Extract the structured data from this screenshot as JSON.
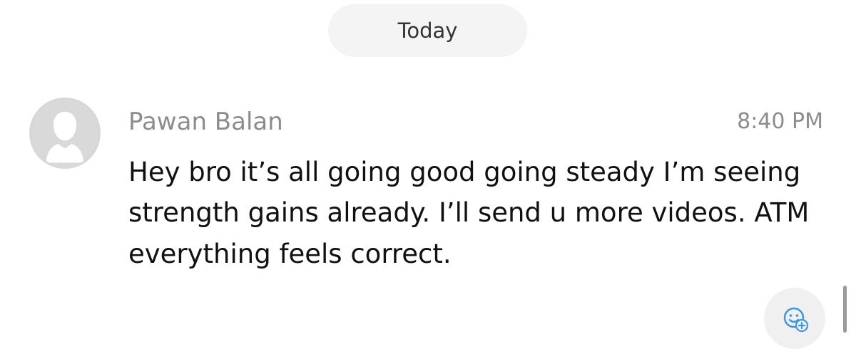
{
  "divider": {
    "date_label": "Today"
  },
  "message": {
    "sender": "Pawan Balan",
    "time": "8:40 PM",
    "text": "Hey bro it’s all going good going steady I’m seeing strength gains already. I’ll send u more videos. ATM everything feels correct."
  },
  "icons": {
    "avatar": "default-user-avatar-icon",
    "reaction": "add-emoji-reaction-icon"
  },
  "colors": {
    "pill_background": "#f4f4f4",
    "meta_text": "#8c8c8c",
    "message_text": "#111111",
    "reaction_icon": "#3e97df"
  }
}
